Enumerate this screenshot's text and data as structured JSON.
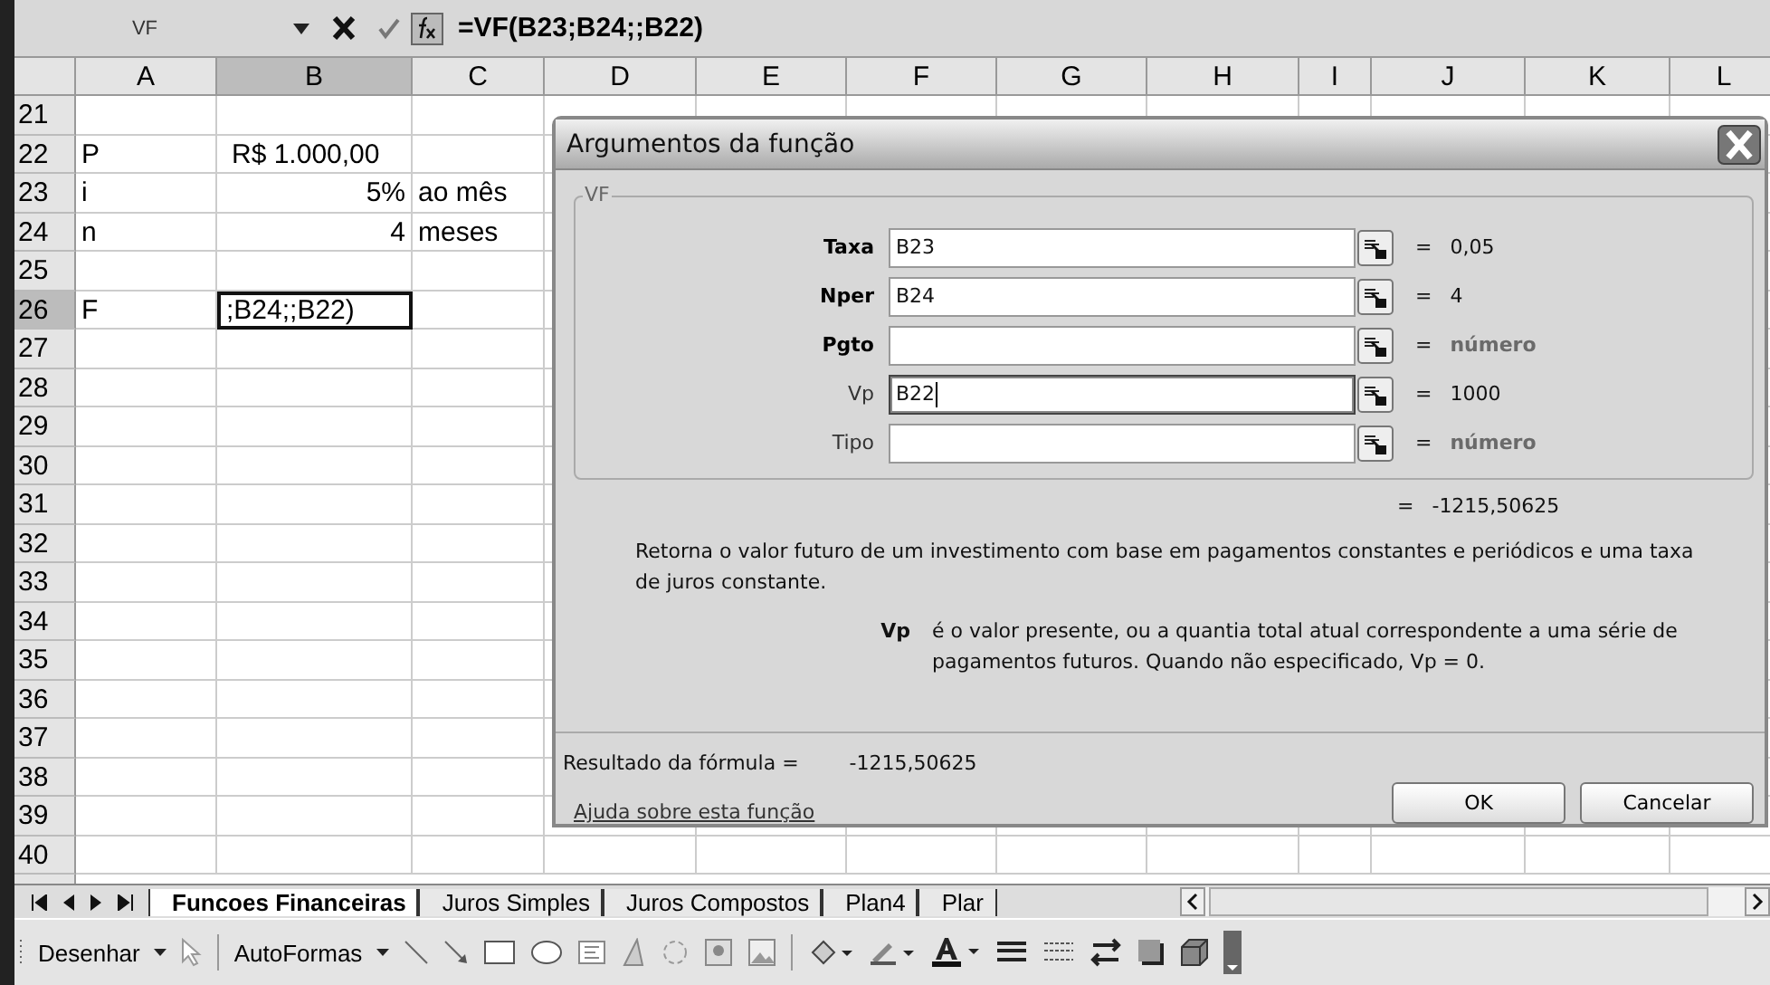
{
  "formula_bar": {
    "name_box": "VF",
    "formula": "=VF(B23;B24;;B22)"
  },
  "columns": [
    {
      "label": "A",
      "selected": false
    },
    {
      "label": "B",
      "selected": true
    },
    {
      "label": "C",
      "selected": false
    },
    {
      "label": "D",
      "selected": false
    },
    {
      "label": "E",
      "selected": false
    },
    {
      "label": "F",
      "selected": false
    },
    {
      "label": "G",
      "selected": false
    },
    {
      "label": "H",
      "selected": false
    },
    {
      "label": "I",
      "selected": false
    },
    {
      "label": "J",
      "selected": false
    },
    {
      "label": "K",
      "selected": false
    },
    {
      "label": "L",
      "selected": false
    }
  ],
  "rows": [
    {
      "number": "21",
      "selected": false
    },
    {
      "number": "22",
      "selected": false,
      "cells": [
        {
          "text": "P",
          "kind": "text"
        },
        {
          "text": "R$ 1.000,00",
          "kind": "currency"
        }
      ]
    },
    {
      "number": "23",
      "selected": false,
      "cells": [
        {
          "text": "i",
          "kind": "text"
        },
        {
          "text": "5%",
          "kind": "number"
        },
        {
          "text": "ao mês",
          "kind": "text"
        }
      ]
    },
    {
      "number": "24",
      "selected": false,
      "cells": [
        {
          "text": "n",
          "kind": "text"
        },
        {
          "text": "4",
          "kind": "number"
        },
        {
          "text": "meses",
          "kind": "text"
        }
      ]
    },
    {
      "number": "25",
      "selected": false
    },
    {
      "number": "26",
      "selected": true,
      "cells": [
        {
          "text": "F",
          "kind": "text"
        },
        {
          "text": ";B24;;B22)",
          "kind": "text",
          "active": true
        }
      ]
    },
    {
      "number": "27",
      "selected": false
    },
    {
      "number": "28",
      "selected": false
    },
    {
      "number": "29",
      "selected": false
    },
    {
      "number": "30",
      "selected": false
    },
    {
      "number": "31",
      "selected": false
    },
    {
      "number": "32",
      "selected": false
    },
    {
      "number": "33",
      "selected": false
    },
    {
      "number": "34",
      "selected": false
    },
    {
      "number": "35",
      "selected": false
    },
    {
      "number": "36",
      "selected": false
    },
    {
      "number": "37",
      "selected": false
    },
    {
      "number": "38",
      "selected": false
    },
    {
      "number": "39",
      "selected": false
    },
    {
      "number": "40",
      "selected": false
    }
  ],
  "dialog": {
    "title": "Argumentos da função",
    "group": "VF",
    "arguments": [
      {
        "label": "Taxa",
        "required": true,
        "value": "B23",
        "focused": false,
        "equals": "=",
        "result": "0,05",
        "hint": false
      },
      {
        "label": "Nper",
        "required": true,
        "value": "B24",
        "focused": false,
        "equals": "=",
        "result": "4",
        "hint": false
      },
      {
        "label": "Pgto",
        "required": true,
        "focused": false,
        "equals": "=",
        "result": "número",
        "hint": true
      },
      {
        "label": "Vp",
        "required": false,
        "value": "B22",
        "focused": true,
        "equals": "=",
        "result": "1000",
        "hint": false
      },
      {
        "label": "Tipo",
        "required": false,
        "focused": false,
        "equals": "=",
        "result": "número",
        "hint": true
      }
    ],
    "result_equals": "=",
    "result": "-1215,50625",
    "description": "Retorna o valor futuro de um investimento com base em pagamentos constantes e periódicos e uma taxa de juros constante.",
    "arg_name": "Vp",
    "arg_help": "é o valor presente, ou a quantia total atual correspondente a uma série de pagamentos futuros. Quando não especificado, Vp = 0.",
    "formula_result_label": "Resultado da fórmula =",
    "formula_result": "-1215,50625",
    "help_link": "Ajuda sobre esta função",
    "buttons": [
      "OK",
      "Cancelar"
    ]
  },
  "sheet_tabs": [
    {
      "label": "Funcoes Financeiras",
      "selected": true
    },
    {
      "label": "Juros Simples",
      "selected": false
    },
    {
      "label": "Juros Compostos",
      "selected": false
    },
    {
      "label": "Plan4",
      "selected": false
    },
    {
      "label": "Plar",
      "selected": false
    }
  ],
  "drawing_toolbar": {
    "menus": [
      "Desenhar",
      "AutoFormas"
    ]
  }
}
